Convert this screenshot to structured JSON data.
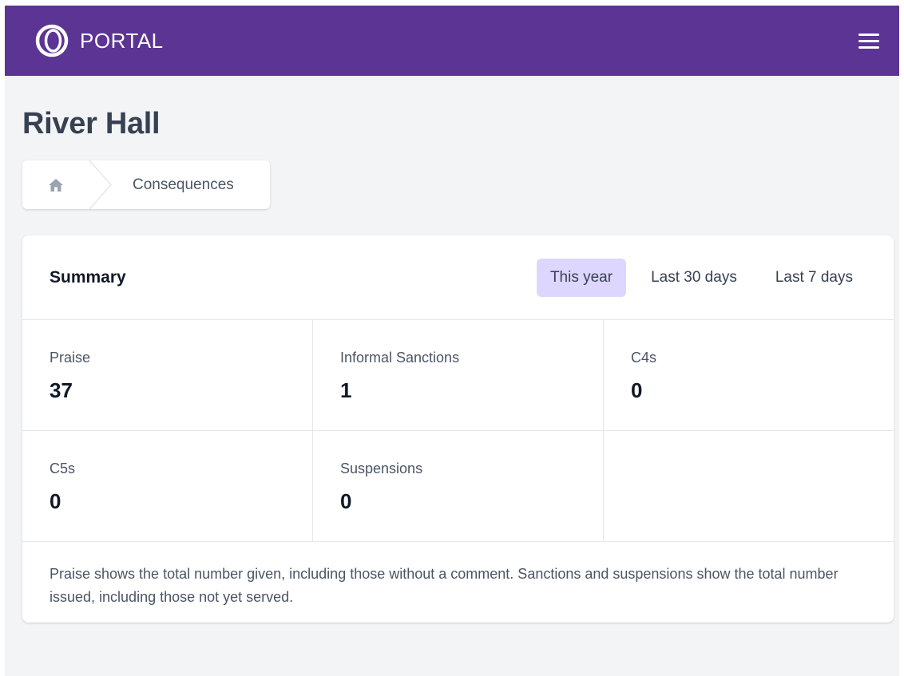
{
  "header": {
    "brand": "PORTAL",
    "logo_icon": "portal-ring-logo",
    "menu_icon": "hamburger-icon",
    "color": "#5b3494"
  },
  "page": {
    "title": "River Hall"
  },
  "breadcrumb": {
    "home_icon": "home-icon",
    "items": [
      "Consequences"
    ]
  },
  "summary": {
    "title": "Summary",
    "tabs": [
      {
        "label": "This year",
        "active": true
      },
      {
        "label": "Last 30 days",
        "active": false
      },
      {
        "label": "Last 7 days",
        "active": false
      }
    ],
    "active_tab_color": "#ddd6fe",
    "stats": [
      {
        "label": "Praise",
        "value": "37"
      },
      {
        "label": "Informal Sanctions",
        "value": "1"
      },
      {
        "label": "C4s",
        "value": "0"
      },
      {
        "label": "C5s",
        "value": "0"
      },
      {
        "label": "Suspensions",
        "value": "0"
      }
    ],
    "footnote": "Praise shows the total number given, including those without a comment. Sanctions and suspensions show the total number issued, including those not yet served."
  }
}
